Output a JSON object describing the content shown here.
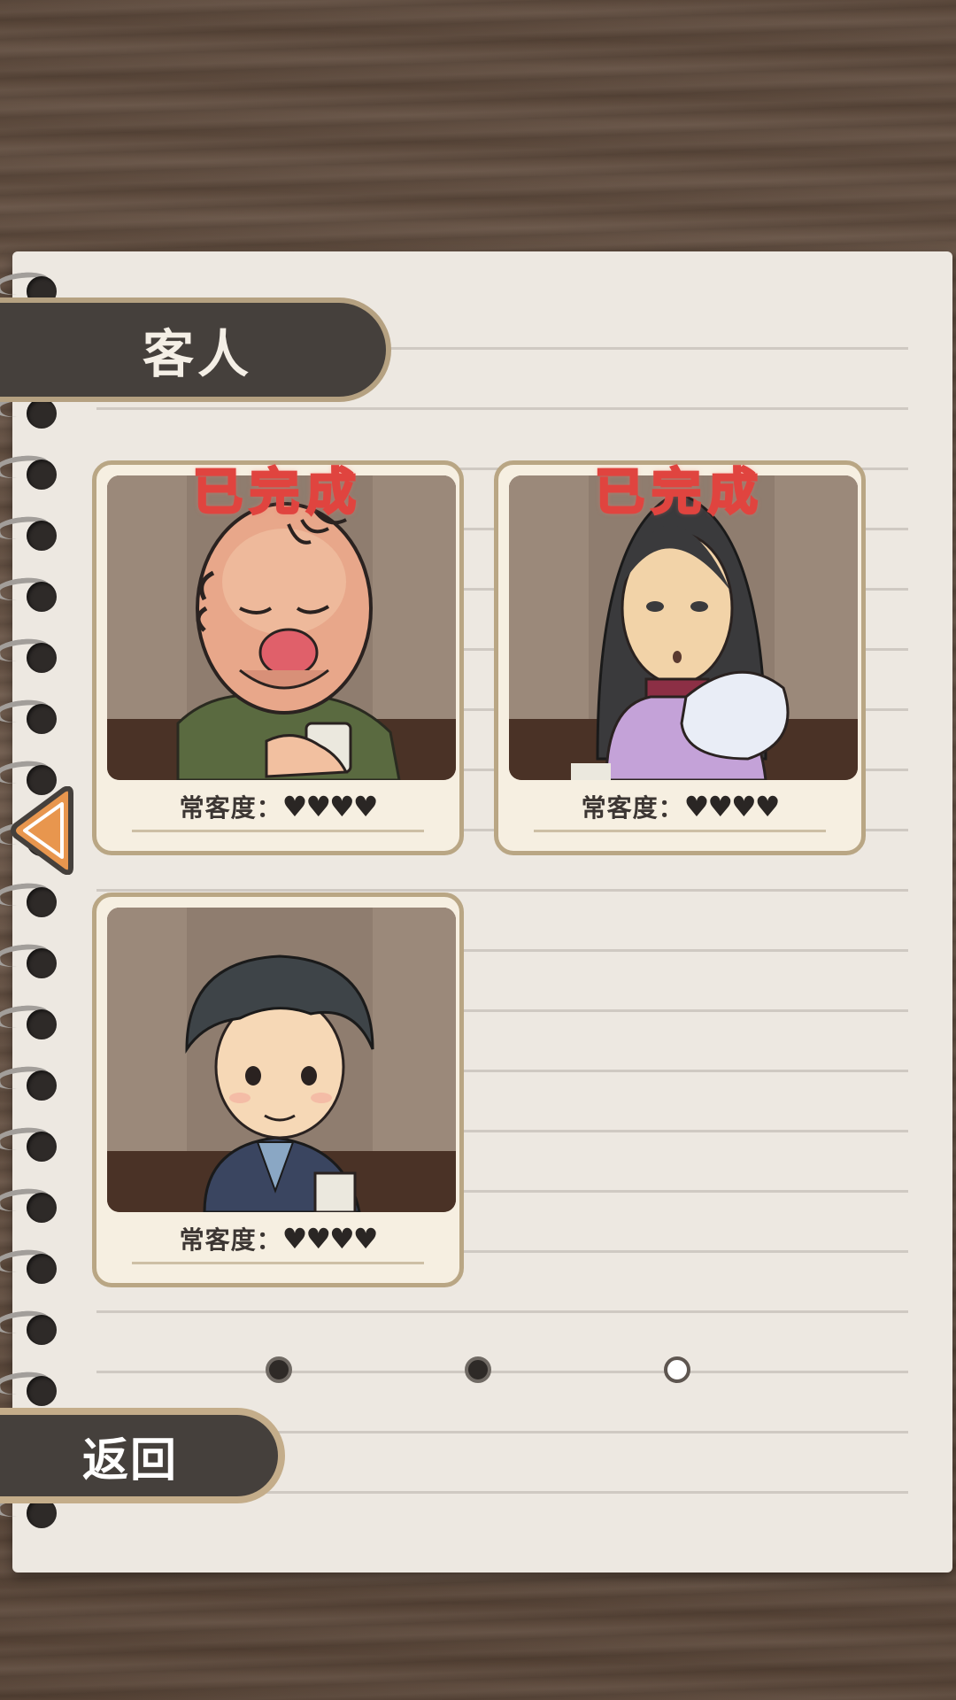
{
  "header": {
    "title": "客人"
  },
  "back_button": {
    "label": "返回"
  },
  "cards": [
    {
      "completed_label": "已完成",
      "regular_label": "常客度：",
      "hearts": "♥♥♥♥",
      "hearts_count": 4,
      "completed": true
    },
    {
      "completed_label": "已完成",
      "regular_label": "常客度：",
      "hearts": "♥♥♥♥",
      "hearts_count": 4,
      "completed": true
    },
    {
      "completed_label": "",
      "regular_label": "常客度：",
      "hearts": "♥♥♥♥",
      "hearts_count": 4,
      "completed": false
    }
  ],
  "pager": {
    "total_pages": 3,
    "current_page": 3
  },
  "colors": {
    "tab_bg": "#45403c",
    "stamp": "#e0443f",
    "arrow": "#e8964e",
    "paper": "#ede8e1"
  }
}
